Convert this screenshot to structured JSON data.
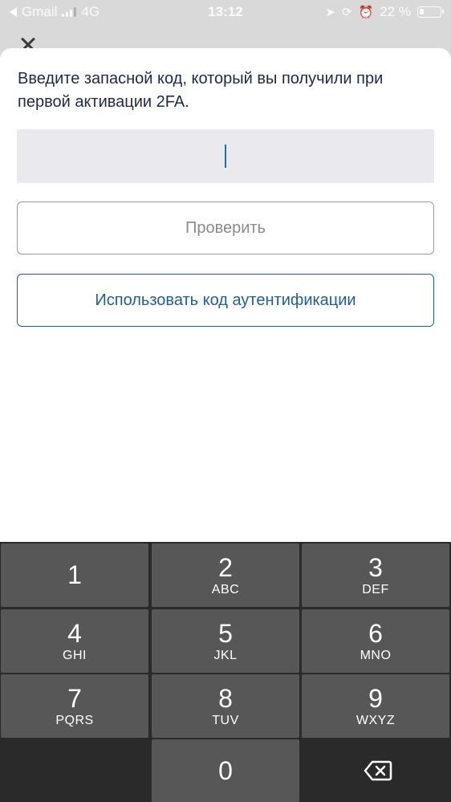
{
  "status_bar": {
    "back_app": "Gmail",
    "network": "4G",
    "time": "13:12",
    "battery_text": "22 %",
    "battery_level": 0.22,
    "icons": [
      "location-arrow-icon",
      "orientation-lock-icon",
      "alarm-icon",
      "battery-icon"
    ]
  },
  "sheet": {
    "instruction": "Введите запасной код, который вы получили при первой активации 2FA.",
    "code_input_value": "",
    "verify_label": "Проверить",
    "use_auth_code_label": "Использовать код аутентификации"
  },
  "keypad": {
    "keys": [
      {
        "digit": "1",
        "letters": ""
      },
      {
        "digit": "2",
        "letters": "ABC"
      },
      {
        "digit": "3",
        "letters": "DEF"
      },
      {
        "digit": "4",
        "letters": "GHI"
      },
      {
        "digit": "5",
        "letters": "JKL"
      },
      {
        "digit": "6",
        "letters": "MNO"
      },
      {
        "digit": "7",
        "letters": "PQRS"
      },
      {
        "digit": "8",
        "letters": "TUV"
      },
      {
        "digit": "9",
        "letters": "WXYZ"
      },
      {
        "digit": "0",
        "letters": ""
      }
    ]
  },
  "colors": {
    "accent": "#1d5f96",
    "instruction_text": "#1e2a44",
    "input_bg": "#e9e9ee",
    "keypad_bg": "#2a2a2a",
    "key_bg": "#575757"
  }
}
